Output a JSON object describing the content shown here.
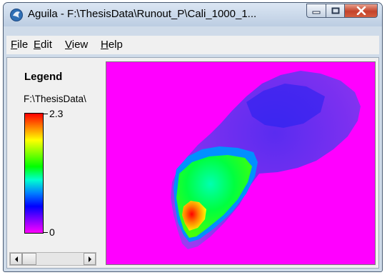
{
  "window": {
    "title": "Aguila - F:\\ThesisData\\Runout_P\\Cali_1000_1..."
  },
  "menu": {
    "items": [
      {
        "key": "file",
        "label": "File",
        "mnemonic": "F"
      },
      {
        "key": "edit",
        "label": "Edit",
        "mnemonic": "E"
      },
      {
        "key": "view",
        "label": "View",
        "mnemonic": "V"
      },
      {
        "key": "help",
        "label": "Help",
        "mnemonic": "H"
      }
    ]
  },
  "legend": {
    "title": "Legend",
    "path": "F:\\ThesisData\\",
    "max_label": "2.3",
    "min_label": "0",
    "colors": [
      "#ff0000",
      "#ff8000",
      "#ffff00",
      "#80ff00",
      "#00ff00",
      "#00ffd0",
      "#0080ff",
      "#0000ff",
      "#8000ff",
      "#ff00ff"
    ]
  },
  "map": {
    "background_color": "#ff00ff"
  },
  "icons": {
    "app": "aguila-app-icon",
    "minimize": "minimize-icon",
    "maximize": "maximize-icon",
    "close": "close-icon",
    "scroll_left": "arrow-left-icon",
    "scroll_right": "arrow-right-icon"
  }
}
